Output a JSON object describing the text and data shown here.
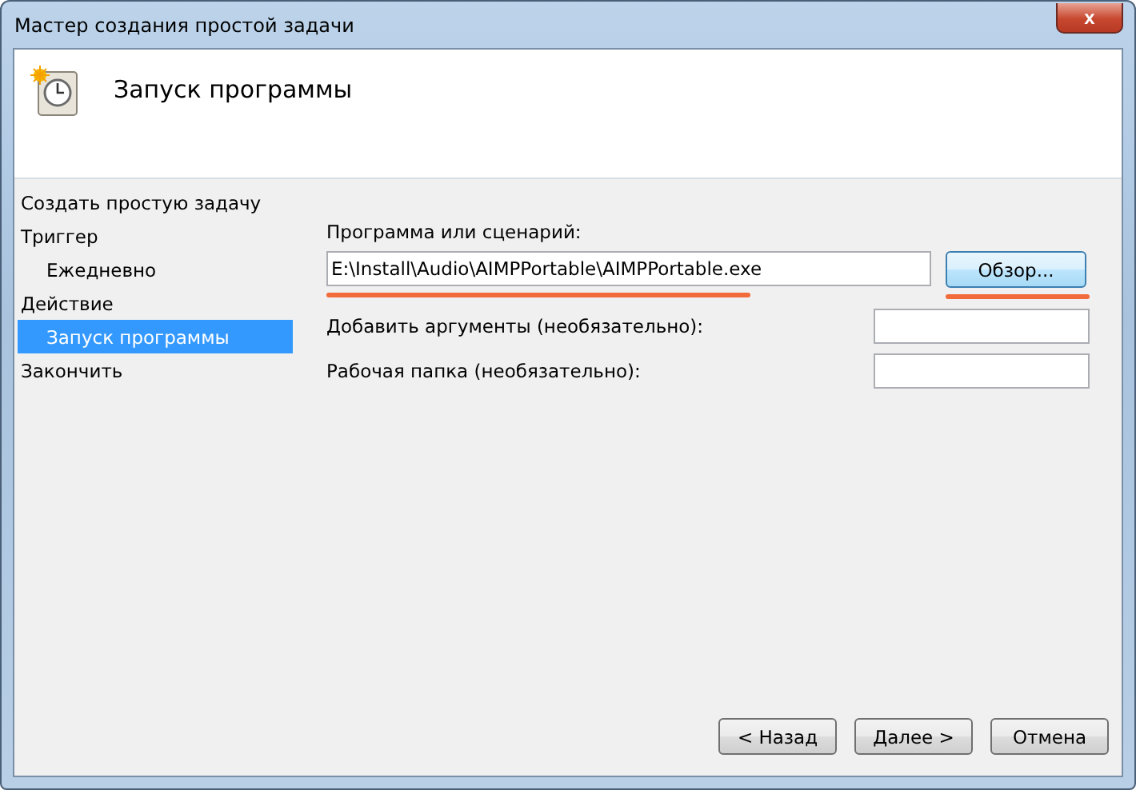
{
  "window": {
    "title": "Мастер создания простой задачи",
    "close_label": "x"
  },
  "header": {
    "title": "Запуск программы"
  },
  "sidebar": {
    "items": [
      {
        "label": "Создать простую задачу",
        "selected": false
      },
      {
        "label": "Триггер",
        "selected": false,
        "children": [
          {
            "label": "Ежедневно",
            "selected": false
          }
        ]
      },
      {
        "label": "Действие",
        "selected": false,
        "children": [
          {
            "label": "Запуск программы",
            "selected": true
          }
        ]
      },
      {
        "label": "Закончить",
        "selected": false
      }
    ]
  },
  "form": {
    "program_label": "Программа или сценарий:",
    "program_value": "E:\\Install\\Audio\\AIMPPortable\\AIMPPortable.exe",
    "program_highlighted": true,
    "browse_button": "Обзор...",
    "browse_highlighted": true,
    "fields": [
      {
        "label": "Добавить аргументы (необязательно):"
      },
      {
        "label": "Рабочая папка (необязательно):"
      }
    ]
  },
  "buttons": [
    "< Назад",
    "Далее >",
    "Отмена"
  ]
}
